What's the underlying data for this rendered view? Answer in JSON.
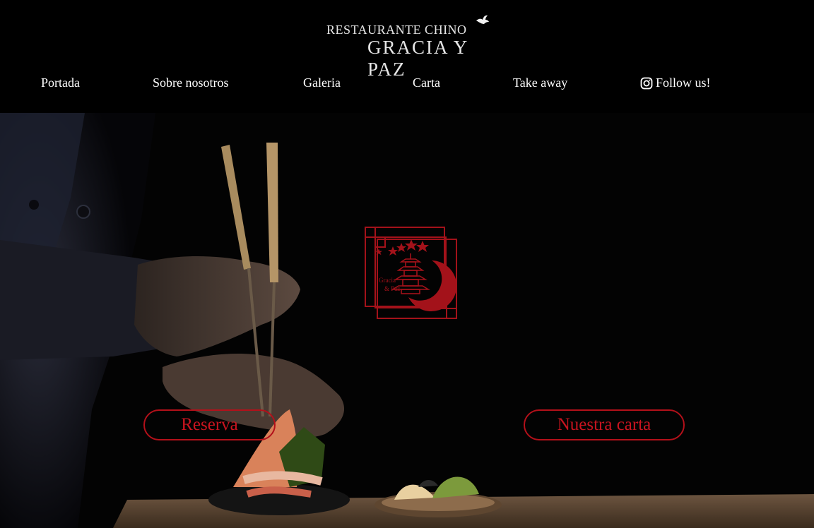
{
  "brand": {
    "line1": "RESTAURANTE CHINO",
    "line2": "GRACIA  Y  PAZ",
    "icon": "dove-icon"
  },
  "nav": {
    "items": [
      {
        "label": "Portada"
      },
      {
        "label": "Sobre nosotros"
      },
      {
        "label": "Galeria"
      },
      {
        "label": "Carta"
      },
      {
        "label": "Take away"
      }
    ],
    "follow": {
      "label": "Follow us!",
      "icon": "instagram-icon"
    }
  },
  "hero": {
    "emblem": {
      "text_line1": "Gracia",
      "text_line2": "& Paz",
      "icon": "pagoda-icon"
    },
    "buttons": {
      "reserve": "Reserva",
      "menu": "Nuestra carta"
    }
  },
  "colors": {
    "background": "#000000",
    "accent_red": "#b3101a",
    "text": "#ffffff"
  }
}
